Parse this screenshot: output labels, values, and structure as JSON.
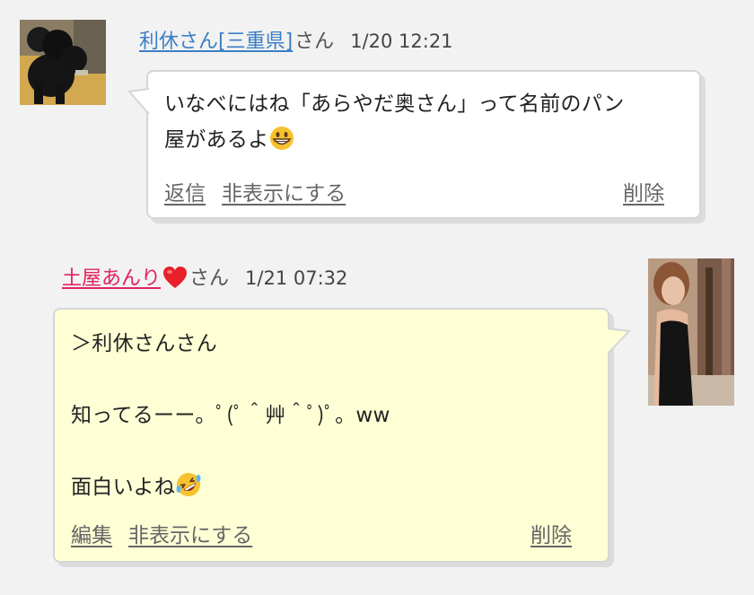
{
  "comments": [
    {
      "author": "利休さん[三重県]",
      "suffix": "さん",
      "time": "1/20 12:21",
      "line1": "いなべにはね「あらやだ奥さん」って名前のパン",
      "line2": "屋があるよ",
      "emoji": "grinning-face-emoji",
      "actions": {
        "reply": "返信",
        "hide": "非表示にする",
        "delete": "削除"
      },
      "name_color": "#3b7fc4",
      "bubble_color": "#ffffff"
    },
    {
      "author": "土屋あんり",
      "author_heart": "heart-emoji",
      "suffix": "さん",
      "time": "1/21 07:32",
      "line1": "＞利休さんさん",
      "line2": "知ってるーー。ﾟ(ﾟ＾艸＾ﾟ)ﾟ。ww",
      "line3": "面白いよね",
      "emoji": "rolling-laughing-emoji",
      "actions": {
        "edit": "編集",
        "hide": "非表示にする",
        "delete": "削除"
      },
      "name_color": "#e0245e",
      "bubble_color": "#ffffd6"
    }
  ]
}
